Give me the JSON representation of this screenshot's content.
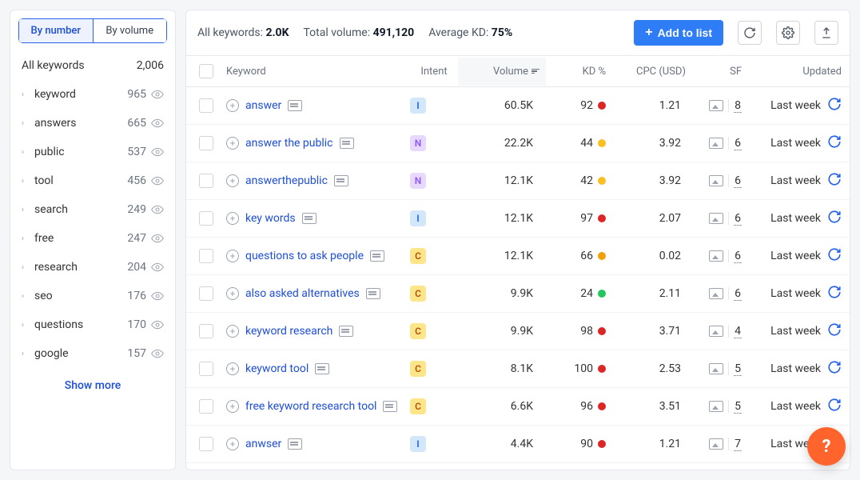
{
  "sidebar": {
    "tabs": {
      "by_number": "By number",
      "by_volume": "By volume"
    },
    "all_label": "All keywords",
    "all_count": "2,006",
    "items": [
      {
        "name": "keyword",
        "count": "965"
      },
      {
        "name": "answers",
        "count": "665"
      },
      {
        "name": "public",
        "count": "537"
      },
      {
        "name": "tool",
        "count": "456"
      },
      {
        "name": "search",
        "count": "249"
      },
      {
        "name": "free",
        "count": "247"
      },
      {
        "name": "research",
        "count": "204"
      },
      {
        "name": "seo",
        "count": "176"
      },
      {
        "name": "questions",
        "count": "170"
      },
      {
        "name": "google",
        "count": "157"
      }
    ],
    "show_more": "Show more"
  },
  "topbar": {
    "all_kw_label": "All keywords: ",
    "all_kw_value": "2.0K",
    "total_vol_label": "Total volume: ",
    "total_vol_value": "491,120",
    "avg_kd_label": "Average KD: ",
    "avg_kd_value": "75%",
    "add_to_list": "Add to list"
  },
  "columns": {
    "keyword": "Keyword",
    "intent": "Intent",
    "volume": "Volume",
    "kd": "KD %",
    "cpc": "CPC (USD)",
    "sf": "SF",
    "updated": "Updated"
  },
  "rows": [
    {
      "keyword": "answer",
      "intent": "I",
      "volume": "60.5K",
      "kd": "92",
      "kd_color": "red",
      "cpc": "1.21",
      "sf": "8",
      "updated": "Last week"
    },
    {
      "keyword": "answer the public",
      "intent": "N",
      "volume": "22.2K",
      "kd": "44",
      "kd_color": "yellow",
      "cpc": "3.92",
      "sf": "6",
      "updated": "Last week"
    },
    {
      "keyword": "answerthepublic",
      "intent": "N",
      "volume": "12.1K",
      "kd": "42",
      "kd_color": "yellow",
      "cpc": "3.92",
      "sf": "6",
      "updated": "Last week"
    },
    {
      "keyword": "key words",
      "intent": "I",
      "volume": "12.1K",
      "kd": "97",
      "kd_color": "red",
      "cpc": "2.07",
      "sf": "6",
      "updated": "Last week"
    },
    {
      "keyword": "questions to ask people",
      "intent": "C",
      "volume": "12.1K",
      "kd": "66",
      "kd_color": "orange",
      "cpc": "0.02",
      "sf": "6",
      "updated": "Last week"
    },
    {
      "keyword": "also asked alternatives",
      "intent": "C",
      "volume": "9.9K",
      "kd": "24",
      "kd_color": "green",
      "cpc": "2.11",
      "sf": "6",
      "updated": "Last week"
    },
    {
      "keyword": "keyword research",
      "intent": "C",
      "volume": "9.9K",
      "kd": "98",
      "kd_color": "red",
      "cpc": "3.71",
      "sf": "4",
      "updated": "Last week"
    },
    {
      "keyword": "keyword tool",
      "intent": "C",
      "volume": "8.1K",
      "kd": "100",
      "kd_color": "red",
      "cpc": "2.53",
      "sf": "5",
      "updated": "Last week"
    },
    {
      "keyword": "free keyword research tool",
      "intent": "C",
      "volume": "6.6K",
      "kd": "96",
      "kd_color": "red",
      "cpc": "3.51",
      "sf": "5",
      "updated": "Last week"
    },
    {
      "keyword": "anwser",
      "intent": "I",
      "volume": "4.4K",
      "kd": "90",
      "kd_color": "red",
      "cpc": "1.21",
      "sf": "7",
      "updated": "Last week"
    }
  ],
  "help": "?"
}
